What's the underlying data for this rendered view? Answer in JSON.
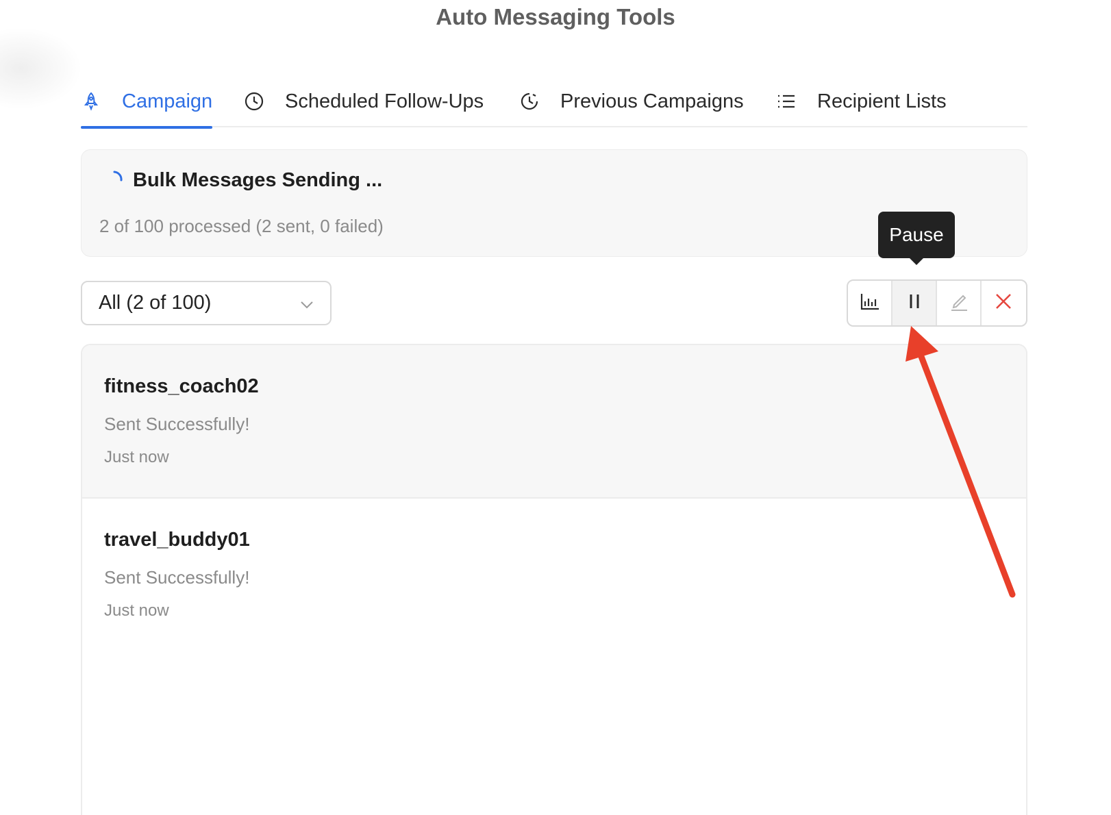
{
  "app": {
    "title": "Auto Messaging Tools"
  },
  "tabs": [
    {
      "label": "Campaign",
      "icon": "rocket-icon",
      "active": true
    },
    {
      "label": "Scheduled Follow-Ups",
      "icon": "clock-icon",
      "active": false
    },
    {
      "label": "Previous Campaigns",
      "icon": "history-icon",
      "active": false
    },
    {
      "label": "Recipient Lists",
      "icon": "list-icon",
      "active": false
    }
  ],
  "status": {
    "title": "Bulk Messages Sending ...",
    "summary": "2 of 100 processed (2 sent, 0 failed)"
  },
  "filter": {
    "selected": "All (2 of 100)"
  },
  "actions": {
    "buttons": [
      {
        "name": "stats",
        "icon": "bar-chart-icon"
      },
      {
        "name": "pause",
        "icon": "pause-icon"
      },
      {
        "name": "edit",
        "icon": "edit-icon"
      },
      {
        "name": "cancel",
        "icon": "close-icon"
      }
    ],
    "tooltip": "Pause"
  },
  "messages": [
    {
      "recipient": "fitness_coach02",
      "status": "Sent Successfully!",
      "time": "Just now"
    },
    {
      "recipient": "travel_buddy01",
      "status": "Sent Successfully!",
      "time": "Just now"
    }
  ],
  "colors": {
    "accent": "#2f6fe4",
    "danger": "#e5473f",
    "annotation_arrow": "#e8402a"
  }
}
